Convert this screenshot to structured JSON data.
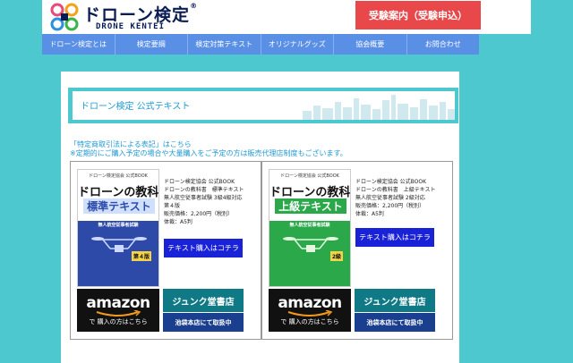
{
  "header": {
    "logo_title": "ドローン検定",
    "logo_reg": "®",
    "logo_sub": "DRONE KENTEI",
    "apply_label": "受験案内（受験申込）"
  },
  "nav": {
    "items": [
      {
        "label": "ドローン検定とは"
      },
      {
        "label": "検定要綱"
      },
      {
        "label": "検定対策テキスト"
      },
      {
        "label": "オリジナルグッズ"
      },
      {
        "label": "協会概要"
      },
      {
        "label": "お問合わせ"
      }
    ]
  },
  "page": {
    "title": "ドローン検定 公式テキスト",
    "commerce_link": "「特定商取引法による表記」はこちら",
    "note": "※定期的にご購入予定の場合や大量購入をご予定の方は販売代理店制度もございます。"
  },
  "products": [
    {
      "cover": {
        "org": "ドローン検定協会 公式BOOK",
        "title": "ドローンの教科書",
        "subtitle": "標準テキスト",
        "exam": "無人航空従事者試験",
        "edition": "第４版",
        "color": "#2e4aa8"
      },
      "info": [
        "ドローン検定協会 公式BOOK",
        "ドローンの教科書　標準テキスト",
        "無人航空従事者試験 3級4級対応",
        "第４版",
        "販売価格：2,200円（税別）",
        "体裁：A5判"
      ],
      "buy_label": "テキスト購入はコチラ",
      "amazon_word": "amazon",
      "amazon_sub": "で 購入の方はこちら",
      "junku_top": "ジュンク堂書店",
      "junku_bottom": "池袋本店にて取扱中"
    },
    {
      "cover": {
        "org": "ドローン検定協会 公式BOOK",
        "title": "ドローンの教科書",
        "subtitle": "上級テキスト",
        "exam": "無人航空従事者試験",
        "edition": "2級",
        "color": "#2aa84a"
      },
      "info": [
        "ドローン検定協会 公式BOOK",
        "ドローンの教科書　上級テキスト",
        "無人航空従事者試験 2級対応",
        "販売価格：2,200円（税別）",
        "体裁：A5判"
      ],
      "buy_label": "テキスト購入はコチラ",
      "amazon_word": "amazon",
      "amazon_sub": "で 購入の方はこちら",
      "junku_top": "ジュンク堂書店",
      "junku_bottom": "池袋本店にて取扱中"
    }
  ],
  "colors": {
    "page_bg": "#4ec8cf",
    "nav_bg": "#5a8fe6",
    "apply_bg": "#e8484a",
    "buy_bg": "#1a22d8",
    "link": "#1f9ad6"
  }
}
